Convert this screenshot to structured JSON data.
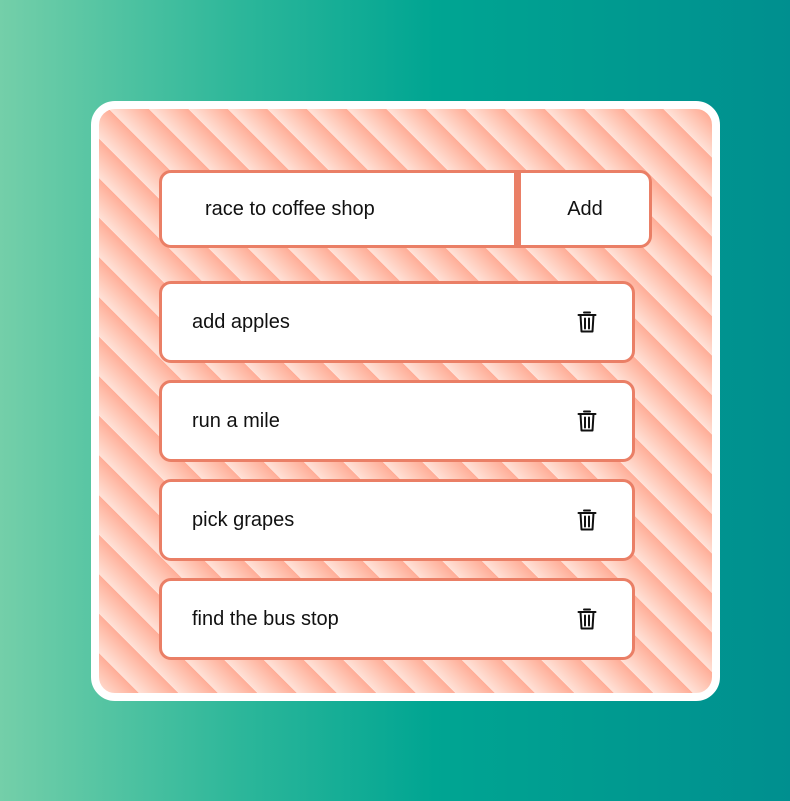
{
  "new_task": {
    "value": "race to coffee shop",
    "placeholder": ""
  },
  "add_button": {
    "label": "Add"
  },
  "tasks": [
    {
      "label": "add apples",
      "icon": "trash-icon"
    },
    {
      "label": "run a mile",
      "icon": "trash-icon"
    },
    {
      "label": "pick grapes",
      "icon": "trash-icon"
    },
    {
      "label": "find the bus stop",
      "icon": "trash-icon"
    }
  ],
  "colors": {
    "accent_border": "#ea7f66",
    "card_border": "#ffffff",
    "stripe_light": "#ffe2d8",
    "stripe_dark": "#ffad97",
    "background_left": "#74cfa9",
    "background_right": "#008f8f"
  }
}
